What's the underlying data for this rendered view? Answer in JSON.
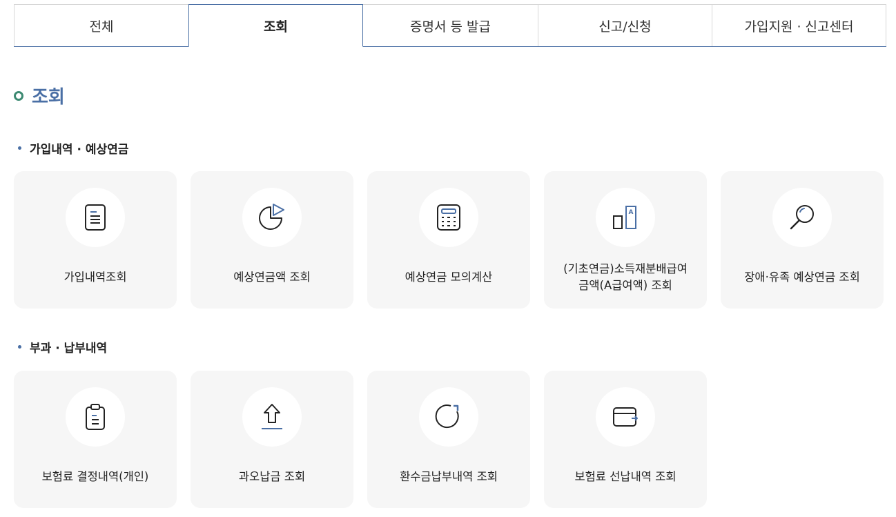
{
  "tabs": [
    {
      "label": "전체"
    },
    {
      "label": "조회"
    },
    {
      "label": "증명서 등 발급"
    },
    {
      "label": "신고/신청"
    },
    {
      "label": "가입지원 · 신고센터"
    }
  ],
  "active_tab": "조회",
  "section": {
    "title": "조회"
  },
  "groups": [
    {
      "heading": "가입내역 · 예상연금",
      "cards": [
        {
          "label": "가입내역조회",
          "icon": "document-icon"
        },
        {
          "label": "예상연금액 조회",
          "icon": "pie-chart-icon"
        },
        {
          "label": "예상연금 모의계산",
          "icon": "calculator-icon"
        },
        {
          "label": "(기초연금)소득재분배급여\n금액(A급여액) 조회",
          "icon": "bar-compare-icon"
        },
        {
          "label": "장애·유족 예상연금 조회",
          "icon": "search-icon"
        }
      ]
    },
    {
      "heading": "부과 · 납부내역",
      "cards": [
        {
          "label": "보험료 결정내역(개인)",
          "icon": "clipboard-icon"
        },
        {
          "label": "과오납금 조회",
          "icon": "upload-icon"
        },
        {
          "label": "환수금납부내역 조회",
          "icon": "refresh-icon"
        },
        {
          "label": "보험료 선납내역 조회",
          "icon": "wallet-icon"
        }
      ]
    }
  ],
  "colors": {
    "accent": "#4a6fa5",
    "title_bullet": "#3d8a72",
    "card_bg": "#f6f6f6",
    "icon_stroke": "#222222"
  }
}
